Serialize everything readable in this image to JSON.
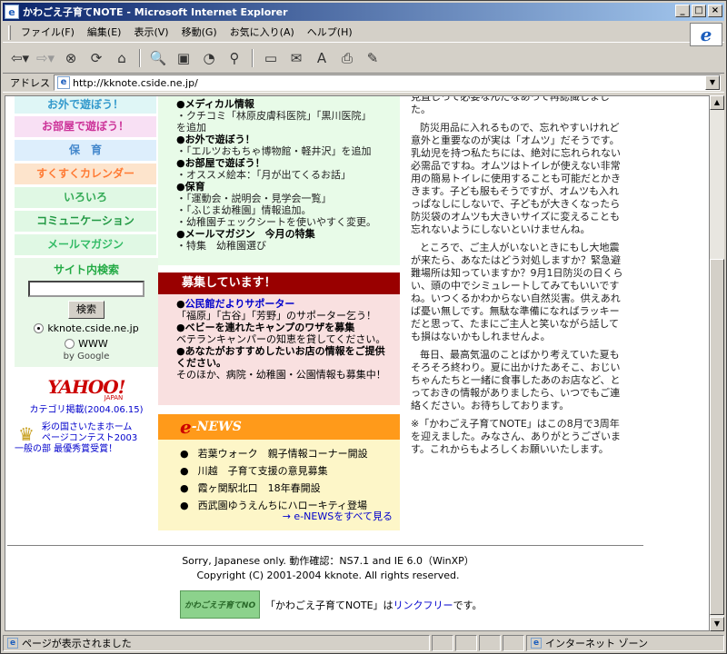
{
  "window": {
    "title": "かわごえ子育てNOTE - Microsoft Internet Explorer",
    "buttons": [
      "_",
      "□",
      "×"
    ]
  },
  "menu": [
    "ファイル(F)",
    "編集(E)",
    "表示(V)",
    "移動(G)",
    "お気に入り(A)",
    "ヘルプ(H)"
  ],
  "toolbar": {
    "icons": [
      "back-icon",
      "forward-icon",
      "stop-icon",
      "refresh-icon",
      "home-icon",
      "search-icon",
      "favorites-icon",
      "history-icon",
      "channels-icon",
      "fullscreen-icon",
      "mail-icon",
      "font-icon",
      "print-icon",
      "edit-icon"
    ]
  },
  "address": {
    "label": "アドレス",
    "url": "http://kknote.cside.ne.jp/"
  },
  "left": {
    "nav": [
      "お外で遊ぼう！",
      "お部屋で遊ぼう！",
      "保　育",
      "すくすくカレンダー",
      "いろいろ",
      "コミュニケーション",
      "メールマガジン"
    ],
    "search_title": "サイト内検索",
    "search_button": "検索",
    "radio1": "kknote.cside.ne.jp",
    "radio2": "WWW",
    "by_google": "by Google",
    "yahoo_logo": "YAHOO!",
    "yahoo_jp": "JAPAN",
    "yahoo_cat": "カテゴリ掲載(2004.06.15)",
    "award1": "彩の国さいたまホーム",
    "award2": "ページコンテスト2003",
    "award3": "一般の部 最優秀賞受賞！"
  },
  "news": [
    {
      "h": "●メディカル情報",
      "b": [
        "・クチコミ「林原皮膚科医院」「黒川医院」",
        "を追加"
      ]
    },
    {
      "h": "●お外で遊ぼう！",
      "b": [
        "・「エルツおもちゃ博物館・軽井沢」を追加"
      ]
    },
    {
      "h": "●お部屋で遊ぼう！",
      "b": [
        "・オススメ絵本：「月が出てくるお話」"
      ]
    },
    {
      "h": "●保育",
      "b": [
        "・「運動会・説明会・見学会一覧」",
        "・「ふじま幼稚園」情報追加。",
        "・幼稚園チェックシートを使いやすく変更。"
      ]
    },
    {
      "h": "●メールマガジン　今月の特集",
      "b": [
        "・特集　幼稚園選び"
      ]
    }
  ],
  "recruit": {
    "header": "募集しています！",
    "items": [
      {
        "t": "公民館だよりサポーター",
        "d": "「福原」「古谷」「芳野」のサポーター乞う！"
      },
      {
        "t": "●ベビーを連れたキャンプのワザを募集",
        "d": "ベテランキャンパーの知恵を貸してください。"
      },
      {
        "t": "●あなたがおすすめしたいお店の情報をご提供ください。",
        "d": "そのほか、病院・幼稚園・公園情報も募集中！"
      }
    ]
  },
  "enews": {
    "e": "e",
    "title": "-NEWS",
    "items": [
      "若葉ウォーク　親子情報コーナー開設",
      "川越　子育て支援の意見募集",
      "霞ヶ関駅北口　18年春開設",
      "西武園ゆうえんちにハローキティ登場"
    ],
    "more": "→ e-NEWSをすべて見る"
  },
  "article": [
    "見直しって必要なんだなあって再認識しました。",
    "防災用品に入れるもので、忘れやすいけれど意外と重要なのが実は「オムツ」だそうです。乳幼児を持つ私たちには、絶対に忘れられない必需品ですね。オムツはトイレが使えない非常用の簡易トイレに使用することも可能だとかききます。子ども服もそうですが、オムツも入れっぱなしにしないで、子どもが大きくなったら防災袋のオムツも大きいサイズに変えることも忘れないようにしないといけませんね。",
    "ところで、ご主人がいないときにもし大地震が来たら、あなたはどう対処しますか？緊急避難場所は知っていますか？9月1日防災の日くらい、頭の中でシミュレートしてみてもいいですね。いつくるかわからない自然災害。供えあれば憂い無しです。無駄な準備になればラッキーだと思って、たまにご主人と笑いながら話しても損はないかもしれませんよ。",
    "毎日、最高気温のことばかり考えていた夏もそろそろ終わり。夏に出かけたあそこ、おじいちゃんたちと一緒に食事したあのお店など、とっておきの情報がありましたら、いつでもご連絡ください。お待ちしております。",
    "※「かわごえ子育てNOTE」はこの8月で3周年を迎えました。みなさん、ありがとうございます。これからもよろしくお願いいたします。"
  ],
  "footer": {
    "line1": "Sorry, Japanese only. 動作確認：NS7.1 and IE 6.0（WinXP）",
    "line2": "Copyright (C) 2001-2004 kknote. All rights reserved.",
    "banner": "かわごえ子育てNO",
    "linkfree_pre": "「かわごえ子育てNOTE」は",
    "linkfree_link": "リンクフリー",
    "linkfree_post": "です。"
  },
  "status": {
    "text": "ページが表示されました",
    "zone": "インターネット ゾーン"
  }
}
